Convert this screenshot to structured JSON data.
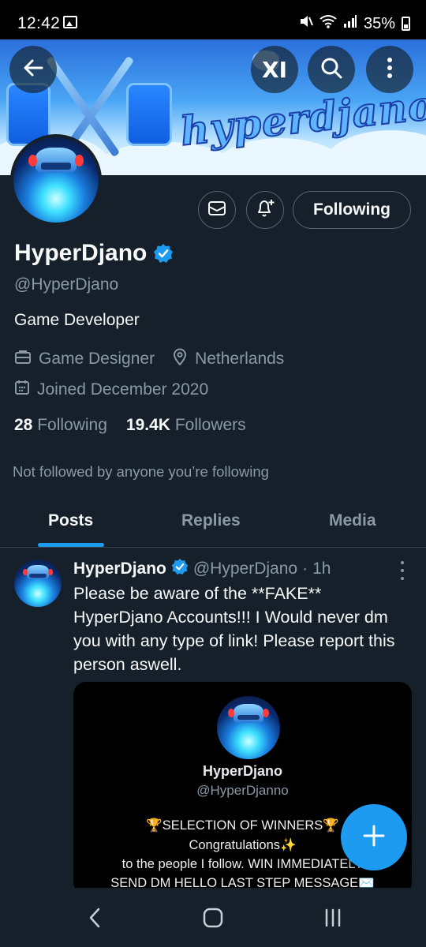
{
  "status_bar": {
    "time": "12:42",
    "battery": "35%",
    "icons": [
      "gallery-icon",
      "mute-icon",
      "wifi-icon",
      "signal-icon",
      "battery-icon"
    ]
  },
  "banner": {
    "logo_text": "hyperdjano"
  },
  "top_nav": {
    "back_icon": "back-arrow-icon",
    "grok_label": "XI",
    "search_icon": "search-icon",
    "more_icon": "more-vertical-icon"
  },
  "profile": {
    "display_name": "HyperDjano",
    "handle": "@HyperDjano",
    "bio": "Game Developer",
    "category": "Game Designer",
    "location": "Netherlands",
    "joined": "Joined December 2020",
    "following_count": "28",
    "following_label": "Following",
    "followers_count": "19.4K",
    "followers_label": "Followers",
    "not_followed_text": "Not followed by anyone you’re following",
    "follow_button_label": "Following"
  },
  "tabs": [
    {
      "label": "Posts",
      "active": true
    },
    {
      "label": "Replies",
      "active": false
    },
    {
      "label": "Media",
      "active": false
    }
  ],
  "post": {
    "author_name": "HyperDjano",
    "author_handle": "@HyperDjano",
    "separator": "·",
    "time": "1h",
    "text": "Please be aware of the **FAKE** HyperDjano Accounts!!! I Would never dm you with any type of link! Please report this person aswell.",
    "media": {
      "name": "HyperDjano",
      "handle": "@HyperDjanno",
      "line1": "🏆SELECTION OF WINNERS🏆",
      "line2": "Congratulations✨",
      "line3": "to the people I follow. WIN IMMEDIATELY",
      "line4": "SEND DM HELLO LAST STEP MESSAGE✉️"
    }
  },
  "colors": {
    "background": "#15202b",
    "accent": "#1d9bf0",
    "secondary_text": "#8b98a5",
    "border": "#536471"
  }
}
